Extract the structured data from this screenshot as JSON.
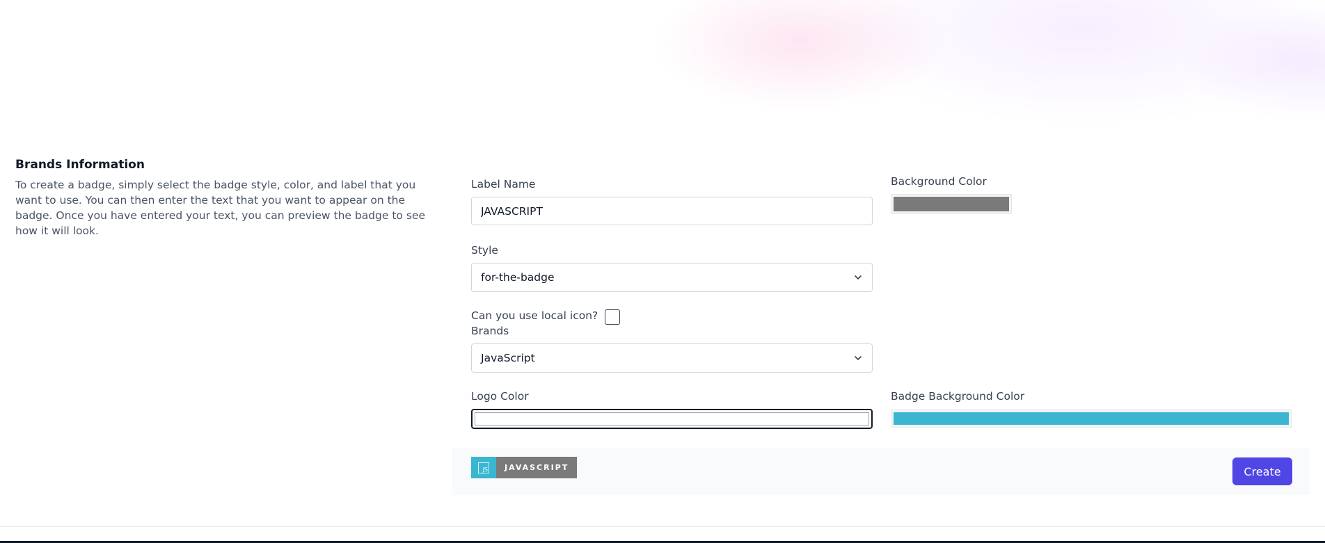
{
  "section": {
    "title": "Brands Information",
    "description": "To create a badge, simply select the badge style, color, and label that you want to use. You can then enter the text that you want to appear on the badge. Once you have entered your text, you can preview the badge to see how it will look."
  },
  "form": {
    "label_name": {
      "label": "Label Name",
      "value": "JAVASCRIPT"
    },
    "background_color": {
      "label": "Background Color",
      "value": "#7a7a7a"
    },
    "style": {
      "label": "Style",
      "selected": "for-the-badge"
    },
    "local_icon": {
      "label": "Can you use local icon?",
      "checked": false
    },
    "brands": {
      "label": "Brands",
      "selected": "JavaScript"
    },
    "logo_color": {
      "label": "Logo Color",
      "value": ""
    },
    "badge_background_color": {
      "label": "Badge Background Color",
      "value": "#3bb6d0"
    }
  },
  "preview": {
    "icon": "javascript-icon",
    "icon_text": "JS",
    "text": "JAVASCRIPT",
    "logo_bg": "#3bb6d0",
    "label_bg": "#7a7a7a"
  },
  "actions": {
    "create_label": "Create"
  },
  "colors": {
    "accent": "#4f46e5"
  }
}
